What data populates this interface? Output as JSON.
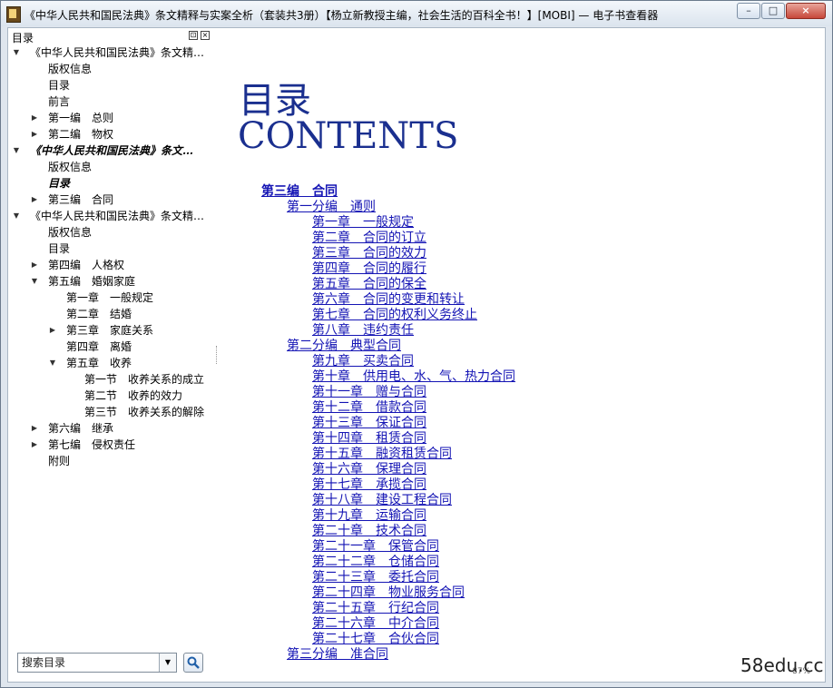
{
  "window": {
    "title": "《中华人民共和国民法典》条文精释与实案全析（套装共3册）【杨立新教授主编，社会生活的百科全书！】[MOBI] — 电子书查看器",
    "minimize": "–",
    "maximize": "□",
    "close": "×"
  },
  "sidebar": {
    "title": "目录",
    "float_symbol": "⊡",
    "close_symbol": "×",
    "search_placeholder": "搜索目录",
    "tree": [
      {
        "label": "《中华人民共和国民法典》条文精…",
        "level": 0,
        "arrow": "down"
      },
      {
        "label": "版权信息",
        "level": 1,
        "arrow": "none"
      },
      {
        "label": "目录",
        "level": 1,
        "arrow": "none"
      },
      {
        "label": "前言",
        "level": 1,
        "arrow": "none"
      },
      {
        "label": "第一编　总则",
        "level": 1,
        "arrow": "right"
      },
      {
        "label": "第二编　物权",
        "level": 1,
        "arrow": "right"
      },
      {
        "label": "《中华人民共和国民法典》条文…",
        "level": 0,
        "arrow": "down",
        "selected": true
      },
      {
        "label": "版权信息",
        "level": 1,
        "arrow": "none"
      },
      {
        "label": "目录",
        "level": 1,
        "arrow": "none",
        "selected": true
      },
      {
        "label": "第三编　合同",
        "level": 1,
        "arrow": "right"
      },
      {
        "label": "《中华人民共和国民法典》条文精…",
        "level": 0,
        "arrow": "down"
      },
      {
        "label": "版权信息",
        "level": 1,
        "arrow": "none"
      },
      {
        "label": "目录",
        "level": 1,
        "arrow": "none"
      },
      {
        "label": "第四编　人格权",
        "level": 1,
        "arrow": "right"
      },
      {
        "label": "第五编　婚姻家庭",
        "level": 1,
        "arrow": "down"
      },
      {
        "label": "第一章　一般规定",
        "level": 2,
        "arrow": "none"
      },
      {
        "label": "第二章　结婚",
        "level": 2,
        "arrow": "none"
      },
      {
        "label": "第三章　家庭关系",
        "level": 2,
        "arrow": "right"
      },
      {
        "label": "第四章　离婚",
        "level": 2,
        "arrow": "none"
      },
      {
        "label": "第五章　收养",
        "level": 2,
        "arrow": "down"
      },
      {
        "label": "第一节　收养关系的成立",
        "level": 3,
        "arrow": "none"
      },
      {
        "label": "第二节　收养的效力",
        "level": 3,
        "arrow": "none"
      },
      {
        "label": "第三节　收养关系的解除",
        "level": 3,
        "arrow": "none"
      },
      {
        "label": "第六编　继承",
        "level": 1,
        "arrow": "right"
      },
      {
        "label": "第七编　侵权责任",
        "level": 1,
        "arrow": "right"
      },
      {
        "label": "附则",
        "level": 1,
        "arrow": "none"
      }
    ]
  },
  "content": {
    "heading_cn": "目录",
    "heading_en": "CONTENTS",
    "toc": [
      {
        "text": "第三编　合同",
        "level": 0
      },
      {
        "text": "第一分编　通则",
        "level": 1
      },
      {
        "text": "第一章　一般规定",
        "level": 2
      },
      {
        "text": "第二章　合同的订立",
        "level": 2
      },
      {
        "text": "第三章　合同的效力",
        "level": 2
      },
      {
        "text": "第四章　合同的履行",
        "level": 2
      },
      {
        "text": "第五章　合同的保全",
        "level": 2
      },
      {
        "text": "第六章　合同的变更和转让",
        "level": 2
      },
      {
        "text": "第七章　合同的权利义务终止",
        "level": 2
      },
      {
        "text": "第八章　违约责任",
        "level": 2
      },
      {
        "text": "第二分编　典型合同",
        "level": 1
      },
      {
        "text": "第九章　买卖合同",
        "level": 2
      },
      {
        "text": "第十章　供用电、水、气、热力合同",
        "level": 2
      },
      {
        "text": "第十一章　赠与合同",
        "level": 2
      },
      {
        "text": "第十二章　借款合同",
        "level": 2
      },
      {
        "text": "第十三章　保证合同",
        "level": 2
      },
      {
        "text": "第十四章　租赁合同",
        "level": 2
      },
      {
        "text": "第十五章　融资租赁合同",
        "level": 2
      },
      {
        "text": "第十六章　保理合同",
        "level": 2
      },
      {
        "text": "第十七章　承揽合同",
        "level": 2
      },
      {
        "text": "第十八章　建设工程合同",
        "level": 2
      },
      {
        "text": "第十九章　运输合同",
        "level": 2
      },
      {
        "text": "第二十章　技术合同",
        "level": 2
      },
      {
        "text": "第二十一章　保管合同",
        "level": 2
      },
      {
        "text": "第二十二章　仓储合同",
        "level": 2
      },
      {
        "text": "第二十三章　委托合同",
        "level": 2
      },
      {
        "text": "第二十四章　物业服务合同",
        "level": 2
      },
      {
        "text": "第二十五章　行纪合同",
        "level": 2
      },
      {
        "text": "第二十六章　中介合同",
        "level": 2
      },
      {
        "text": "第二十七章　合伙合同",
        "level": 2
      },
      {
        "text": "第三分编　准合同",
        "level": 1
      }
    ],
    "zoom": "87%"
  },
  "watermark": "58edu.cc",
  "colors": {
    "link": "#1414b4",
    "heading": "#1a2f8f"
  }
}
